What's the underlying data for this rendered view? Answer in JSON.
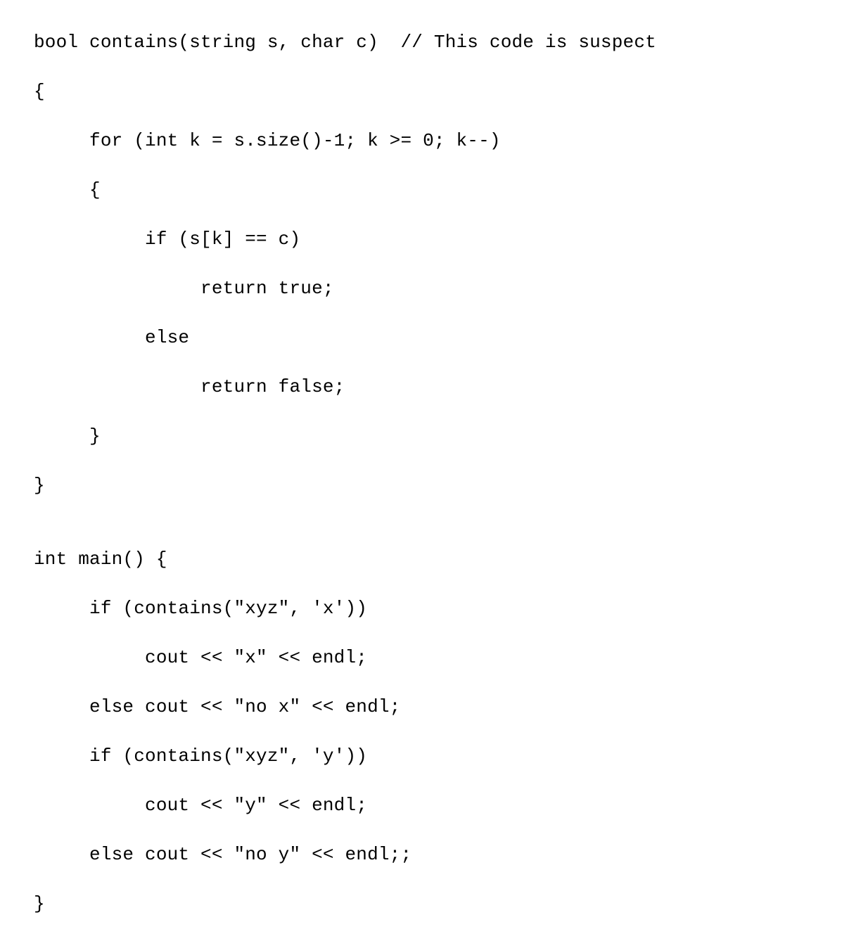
{
  "code": {
    "lines": [
      "bool contains(string s, char c)  // This code is suspect",
      "{",
      "     for (int k = s.size()-1; k >= 0; k--)",
      "     {",
      "          if (s[k] == c)",
      "               return true;",
      "          else",
      "               return false;",
      "     }",
      "}",
      "",
      "int main() {",
      "     if (contains(\"xyz\", 'x'))",
      "          cout << \"x\" << endl;",
      "     else cout << \"no x\" << endl;",
      "     if (contains(\"xyz\", 'y'))",
      "          cout << \"y\" << endl;",
      "     else cout << \"no y\" << endl;;",
      "}"
    ]
  }
}
